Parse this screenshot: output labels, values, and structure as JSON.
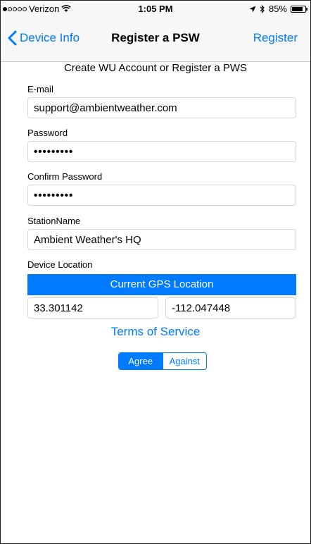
{
  "status_bar": {
    "carrier": "Verizon",
    "time": "1:05 PM",
    "battery_text": "85%",
    "battery_level": 0.85,
    "signal_bars_filled": 1,
    "signal_bars_total": 5
  },
  "nav": {
    "back_label": "Device Info",
    "title": "Register a PSW",
    "action_label": "Register"
  },
  "form": {
    "heading": "Create WU Account or Register a PWS",
    "email_label": "E-mail",
    "email_value": "support@ambientweather.com",
    "password_label": "Password",
    "password_mask": "•••••••••",
    "confirm_label": "Confirm Password",
    "confirm_mask": "•••••••••",
    "station_label": "StationName",
    "station_value": "Ambient Weather's HQ",
    "location_label": "Device Location",
    "gps_button_label": "Current GPS Location",
    "latitude": "33.301142",
    "longitude": "-112.047448",
    "terms_link": "Terms of Service",
    "agree_label": "Agree",
    "against_label": "Against",
    "selected_option": "Agree"
  },
  "colors": {
    "accent": "#007aff",
    "bar_background": "#f7f7f7"
  },
  "icons": [
    "wifi-icon",
    "location-arrow-icon",
    "bluetooth-icon",
    "battery-icon",
    "chevron-left-icon"
  ]
}
